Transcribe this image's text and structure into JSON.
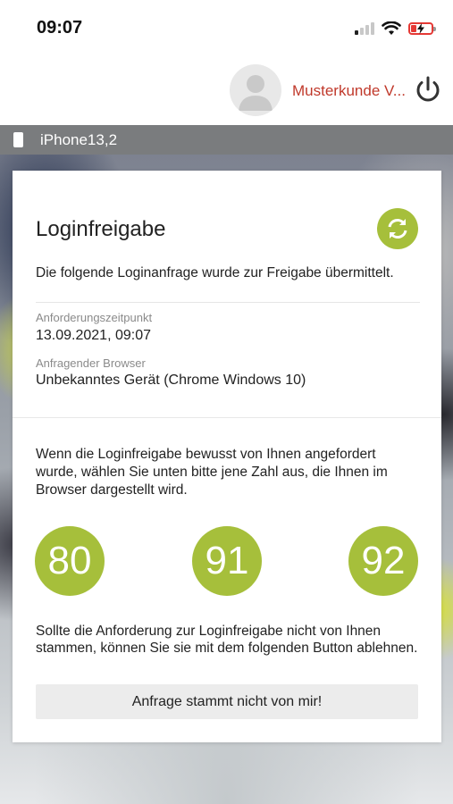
{
  "status_bar": {
    "time": "09:07",
    "icons": [
      "cellular-signal-icon",
      "wifi-icon",
      "battery-charging-icon"
    ],
    "battery_color": "#e53935"
  },
  "header": {
    "user_name": "Musterkunde V...",
    "avatar_icon": "user-avatar-icon",
    "power_icon": "power-icon"
  },
  "device_bar": {
    "device_name": "iPhone13,2",
    "icon": "phone-icon"
  },
  "card": {
    "title": "Loginfreigabe",
    "refresh_icon": "refresh-icon",
    "intro": "Die folgende Loginanfrage wurde zur Freigabe übermittelt.",
    "fields": [
      {
        "label": "Anforderungszeitpunkt",
        "value": "13.09.2021, 09:07"
      },
      {
        "label": "Anfragender Browser",
        "value": "Unbekanntes Gerät (Chrome Windows 10)"
      }
    ],
    "instruction": "Wenn die Loginfreigabe bewusst von Ihnen angefordert wurde, wählen Sie unten bitte jene Zahl aus, die Ihnen im Browser dargestellt wird.",
    "numbers": [
      "80",
      "91",
      "92"
    ],
    "deny_text": "Sollte die Anforderung zur Loginfreigabe nicht von Ihnen stammen, können Sie sie mit dem folgenden Button ablehnen.",
    "deny_button": "Anfrage stammt nicht von mir!"
  },
  "colors": {
    "accent": "#a6bf3b",
    "user_name": "#c0392b",
    "device_bar": "#7a7c7e"
  }
}
